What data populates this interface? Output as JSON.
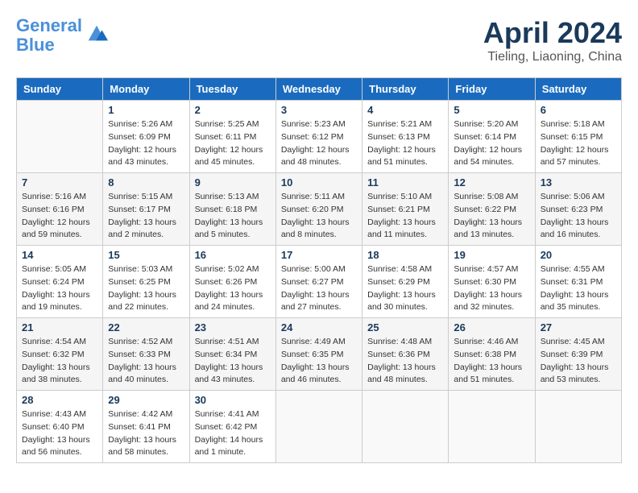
{
  "logo": {
    "line1": "General",
    "line2": "Blue"
  },
  "title": "April 2024",
  "subtitle": "Tieling, Liaoning, China",
  "days_header": [
    "Sunday",
    "Monday",
    "Tuesday",
    "Wednesday",
    "Thursday",
    "Friday",
    "Saturday"
  ],
  "weeks": [
    [
      {
        "day": "",
        "info": ""
      },
      {
        "day": "1",
        "info": "Sunrise: 5:26 AM\nSunset: 6:09 PM\nDaylight: 12 hours\nand 43 minutes."
      },
      {
        "day": "2",
        "info": "Sunrise: 5:25 AM\nSunset: 6:11 PM\nDaylight: 12 hours\nand 45 minutes."
      },
      {
        "day": "3",
        "info": "Sunrise: 5:23 AM\nSunset: 6:12 PM\nDaylight: 12 hours\nand 48 minutes."
      },
      {
        "day": "4",
        "info": "Sunrise: 5:21 AM\nSunset: 6:13 PM\nDaylight: 12 hours\nand 51 minutes."
      },
      {
        "day": "5",
        "info": "Sunrise: 5:20 AM\nSunset: 6:14 PM\nDaylight: 12 hours\nand 54 minutes."
      },
      {
        "day": "6",
        "info": "Sunrise: 5:18 AM\nSunset: 6:15 PM\nDaylight: 12 hours\nand 57 minutes."
      }
    ],
    [
      {
        "day": "7",
        "info": "Sunrise: 5:16 AM\nSunset: 6:16 PM\nDaylight: 12 hours\nand 59 minutes."
      },
      {
        "day": "8",
        "info": "Sunrise: 5:15 AM\nSunset: 6:17 PM\nDaylight: 13 hours\nand 2 minutes."
      },
      {
        "day": "9",
        "info": "Sunrise: 5:13 AM\nSunset: 6:18 PM\nDaylight: 13 hours\nand 5 minutes."
      },
      {
        "day": "10",
        "info": "Sunrise: 5:11 AM\nSunset: 6:20 PM\nDaylight: 13 hours\nand 8 minutes."
      },
      {
        "day": "11",
        "info": "Sunrise: 5:10 AM\nSunset: 6:21 PM\nDaylight: 13 hours\nand 11 minutes."
      },
      {
        "day": "12",
        "info": "Sunrise: 5:08 AM\nSunset: 6:22 PM\nDaylight: 13 hours\nand 13 minutes."
      },
      {
        "day": "13",
        "info": "Sunrise: 5:06 AM\nSunset: 6:23 PM\nDaylight: 13 hours\nand 16 minutes."
      }
    ],
    [
      {
        "day": "14",
        "info": "Sunrise: 5:05 AM\nSunset: 6:24 PM\nDaylight: 13 hours\nand 19 minutes."
      },
      {
        "day": "15",
        "info": "Sunrise: 5:03 AM\nSunset: 6:25 PM\nDaylight: 13 hours\nand 22 minutes."
      },
      {
        "day": "16",
        "info": "Sunrise: 5:02 AM\nSunset: 6:26 PM\nDaylight: 13 hours\nand 24 minutes."
      },
      {
        "day": "17",
        "info": "Sunrise: 5:00 AM\nSunset: 6:27 PM\nDaylight: 13 hours\nand 27 minutes."
      },
      {
        "day": "18",
        "info": "Sunrise: 4:58 AM\nSunset: 6:29 PM\nDaylight: 13 hours\nand 30 minutes."
      },
      {
        "day": "19",
        "info": "Sunrise: 4:57 AM\nSunset: 6:30 PM\nDaylight: 13 hours\nand 32 minutes."
      },
      {
        "day": "20",
        "info": "Sunrise: 4:55 AM\nSunset: 6:31 PM\nDaylight: 13 hours\nand 35 minutes."
      }
    ],
    [
      {
        "day": "21",
        "info": "Sunrise: 4:54 AM\nSunset: 6:32 PM\nDaylight: 13 hours\nand 38 minutes."
      },
      {
        "day": "22",
        "info": "Sunrise: 4:52 AM\nSunset: 6:33 PM\nDaylight: 13 hours\nand 40 minutes."
      },
      {
        "day": "23",
        "info": "Sunrise: 4:51 AM\nSunset: 6:34 PM\nDaylight: 13 hours\nand 43 minutes."
      },
      {
        "day": "24",
        "info": "Sunrise: 4:49 AM\nSunset: 6:35 PM\nDaylight: 13 hours\nand 46 minutes."
      },
      {
        "day": "25",
        "info": "Sunrise: 4:48 AM\nSunset: 6:36 PM\nDaylight: 13 hours\nand 48 minutes."
      },
      {
        "day": "26",
        "info": "Sunrise: 4:46 AM\nSunset: 6:38 PM\nDaylight: 13 hours\nand 51 minutes."
      },
      {
        "day": "27",
        "info": "Sunrise: 4:45 AM\nSunset: 6:39 PM\nDaylight: 13 hours\nand 53 minutes."
      }
    ],
    [
      {
        "day": "28",
        "info": "Sunrise: 4:43 AM\nSunset: 6:40 PM\nDaylight: 13 hours\nand 56 minutes."
      },
      {
        "day": "29",
        "info": "Sunrise: 4:42 AM\nSunset: 6:41 PM\nDaylight: 13 hours\nand 58 minutes."
      },
      {
        "day": "30",
        "info": "Sunrise: 4:41 AM\nSunset: 6:42 PM\nDaylight: 14 hours\nand 1 minute."
      },
      {
        "day": "",
        "info": ""
      },
      {
        "day": "",
        "info": ""
      },
      {
        "day": "",
        "info": ""
      },
      {
        "day": "",
        "info": ""
      }
    ]
  ]
}
